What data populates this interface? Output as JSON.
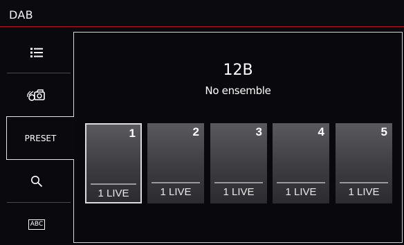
{
  "window": {
    "title": "DAB"
  },
  "sidebar": {
    "items": [
      {
        "icon": "list-icon"
      },
      {
        "icon": "scan-icon"
      },
      {
        "label": "PRESET",
        "selected": true
      },
      {
        "icon": "search-icon"
      },
      {
        "icon": "abc-icon",
        "text": "ABC"
      }
    ]
  },
  "station": {
    "frequency": "12B",
    "ensemble": "No ensemble"
  },
  "presets": [
    {
      "number": "1",
      "name": "1 LIVE",
      "active": true
    },
    {
      "number": "2",
      "name": "1 LIVE"
    },
    {
      "number": "3",
      "name": "1 LIVE"
    },
    {
      "number": "4",
      "name": "1 LIVE"
    },
    {
      "number": "5",
      "name": "1 LIVE"
    }
  ],
  "colors": {
    "accent_line": "#b3121c",
    "tile_top": "#5a5a5e",
    "tile_bottom": "#2c2c30"
  }
}
